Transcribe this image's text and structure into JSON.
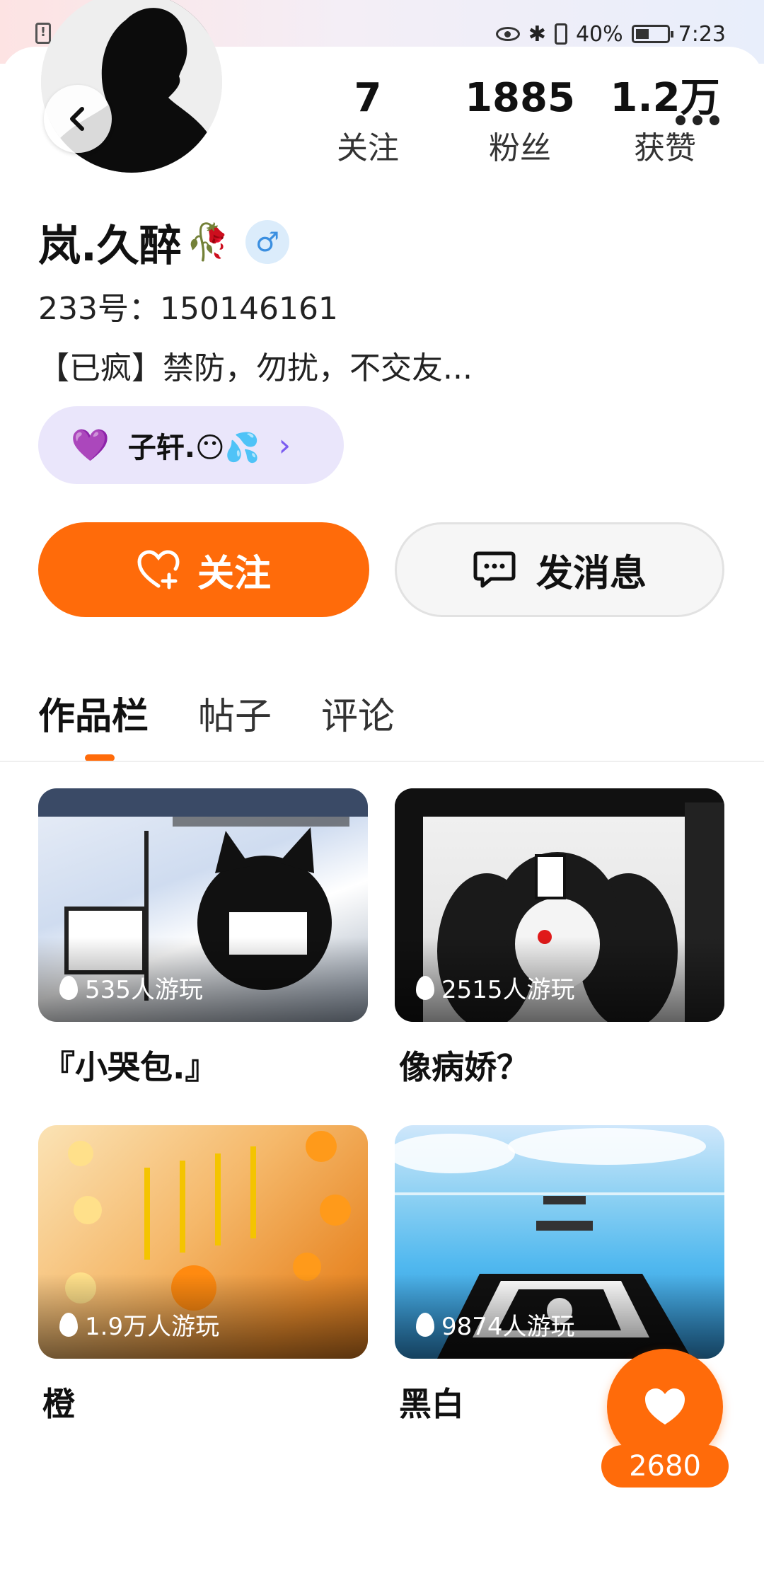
{
  "status_bar": {
    "battery_percent": "40%",
    "time": "7:23"
  },
  "profile": {
    "stats": [
      {
        "value": "7",
        "label": "关注"
      },
      {
        "value": "1885",
        "label": "粉丝"
      },
      {
        "value": "1.2万",
        "label": "获赞"
      }
    ],
    "name": "岚.久醉",
    "name_emoji": "🥀",
    "gender_symbol": "♂",
    "uid": "233号：150146161",
    "bio": "【已疯】禁防，勿扰，不交友...",
    "relation": {
      "heart": "💜",
      "text": "子轩.😶💦",
      "arrow": "›"
    }
  },
  "actions": {
    "follow_label": "关注",
    "message_label": "发消息"
  },
  "tabs": [
    {
      "label": "作品栏",
      "active": true
    },
    {
      "label": "帖子",
      "active": false
    },
    {
      "label": "评论",
      "active": false
    }
  ],
  "works": [
    {
      "title": "『小哭包.』",
      "plays": "535人游玩"
    },
    {
      "title": "像病娇？",
      "plays": "2515人游玩"
    },
    {
      "title": "橙",
      "plays": "1.9万人游玩"
    },
    {
      "title": "黑白",
      "plays": "9874人游玩"
    }
  ],
  "like_fab": {
    "count": "2680"
  },
  "colors": {
    "accent": "#ff6b0a",
    "chip_bg": "#eae6fb",
    "chip_accent": "#7b5cf0",
    "gender_bg": "#dbecfb"
  }
}
